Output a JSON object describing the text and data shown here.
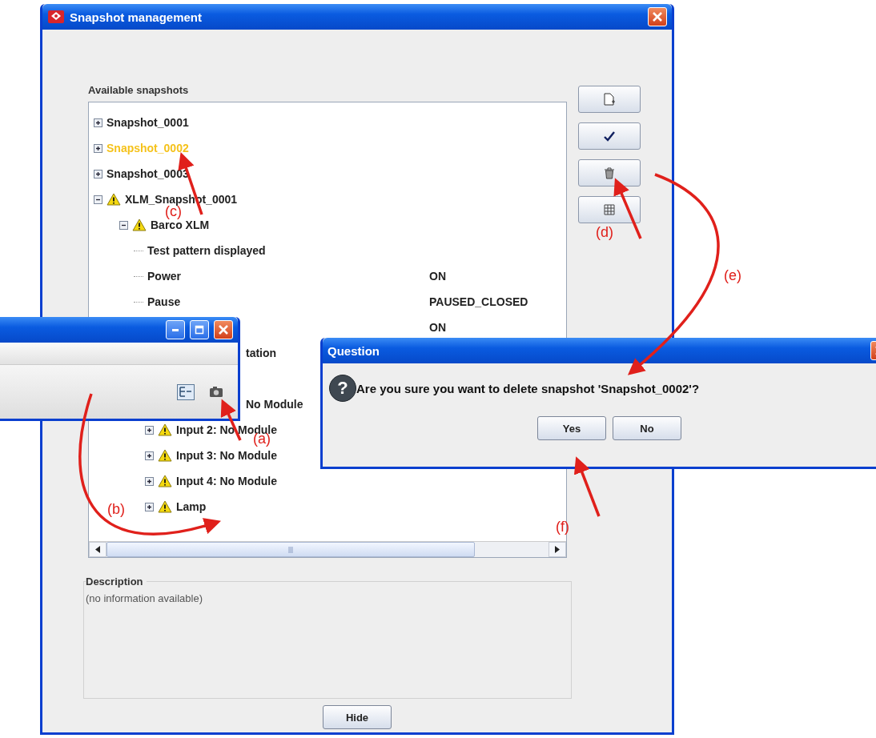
{
  "main_window": {
    "title": "Snapshot management",
    "available_group": {
      "label": "Available snapshots",
      "tree": [
        {
          "kind": "node",
          "label": "Snapshot_0001",
          "expanded": false,
          "warning": false,
          "selected": false
        },
        {
          "kind": "node",
          "label": "Snapshot_0002",
          "expanded": false,
          "warning": false,
          "selected": true
        },
        {
          "kind": "node",
          "label": "Snapshot_0003",
          "expanded": false,
          "warning": false,
          "selected": false
        },
        {
          "kind": "node",
          "label": "XLM_Snapshot_0001",
          "expanded": true,
          "warning": true,
          "selected": false,
          "children": [
            {
              "kind": "node",
              "label": "Barco XLM",
              "expanded": true,
              "warning": true,
              "selected": false,
              "children": [
                {
                  "kind": "property",
                  "name": "Test pattern displayed"
                },
                {
                  "kind": "property",
                  "name": "Power",
                  "value": "ON"
                },
                {
                  "kind": "property",
                  "name": "Pause",
                  "value": "PAUSED_CLOSED"
                },
                {
                  "kind": "clipped",
                  "value": "ON"
                },
                {
                  "kind": "clipped",
                  "name": "tation"
                },
                {
                  "kind": "clipped"
                },
                {
                  "kind": "clipped",
                  "name": "No Module"
                },
                {
                  "kind": "node",
                  "label": "Input 2: No Module",
                  "expanded": false,
                  "warning": true,
                  "selected": false
                },
                {
                  "kind": "node",
                  "label": "Input 3: No Module",
                  "expanded": false,
                  "warning": true,
                  "selected": false
                },
                {
                  "kind": "node",
                  "label": "Input 4: No Module",
                  "expanded": false,
                  "warning": true,
                  "selected": false
                },
                {
                  "kind": "node",
                  "label": "Lamp",
                  "expanded": false,
                  "warning": true,
                  "selected": false
                }
              ]
            }
          ]
        }
      ]
    },
    "description_group": {
      "label": "Description",
      "text": "(no information available)"
    },
    "hide_button": "Hide"
  },
  "question_dialog": {
    "title": "Question",
    "icon_glyph": "?",
    "message": "Are you sure you want to delete snapshot 'Snapshot_0002'?",
    "buttons": [
      "Yes",
      "No"
    ]
  },
  "annotations": [
    {
      "label": "(a)"
    },
    {
      "label": "(b)"
    },
    {
      "label": "(c)"
    },
    {
      "label": "(d)"
    },
    {
      "label": "(e)"
    },
    {
      "label": "(f)"
    }
  ]
}
